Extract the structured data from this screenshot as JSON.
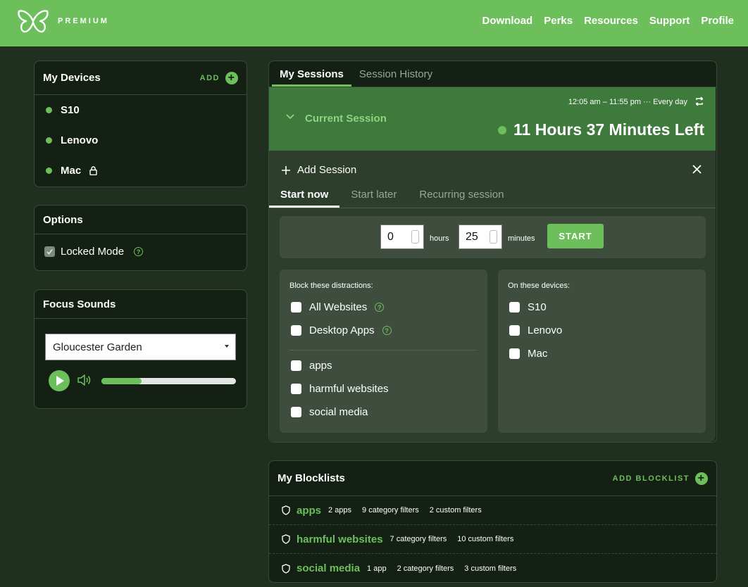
{
  "header": {
    "brand": "PREMIUM",
    "nav": [
      "Download",
      "Perks",
      "Resources",
      "Support",
      "Profile"
    ]
  },
  "devices": {
    "title": "My Devices",
    "add_label": "ADD",
    "items": [
      {
        "name": "S10",
        "locked": false
      },
      {
        "name": "Lenovo",
        "locked": false
      },
      {
        "name": "Mac",
        "locked": true
      }
    ]
  },
  "options": {
    "title": "Options",
    "locked_mode": "Locked Mode"
  },
  "focus_sounds": {
    "title": "Focus Sounds",
    "selected": "Gloucester Garden",
    "volume": 0.3
  },
  "sessions": {
    "tabs": [
      "My Sessions",
      "Session History"
    ],
    "current": {
      "label": "Current Session",
      "time_range": "12:05 am – 11:55 pm ··· Every day",
      "time_left": "11 Hours 37 Minutes Left"
    },
    "add": {
      "title": "Add Session",
      "subtabs": [
        "Start now",
        "Start later",
        "Recurring session"
      ],
      "hours_value": "0",
      "hours_label": "hours",
      "minutes_value": "25",
      "minutes_label": "minutes",
      "start_label": "START",
      "distractions_label": "Block these distractions:",
      "distractions": [
        "All Websites",
        "Desktop Apps"
      ],
      "blocklists": [
        "apps",
        "harmful websites",
        "social media"
      ],
      "devices_label": "On these devices:",
      "devices": [
        "S10",
        "Lenovo",
        "Mac"
      ]
    }
  },
  "blocklists": {
    "title": "My Blocklists",
    "add_label": "ADD BLOCKLIST",
    "items": [
      {
        "name": "apps",
        "meta": [
          "2 apps",
          "9 category filters",
          "2 custom filters"
        ]
      },
      {
        "name": "harmful websites",
        "meta": [
          "7 category filters",
          "10 custom filters"
        ]
      },
      {
        "name": "social media",
        "meta": [
          "1 app",
          "2 category filters",
          "3 custom filters"
        ]
      }
    ]
  },
  "colors": {
    "accent": "#6cbf5b",
    "background": "#1f3020",
    "card": "#142014",
    "session_band": "#3d7a3c"
  }
}
